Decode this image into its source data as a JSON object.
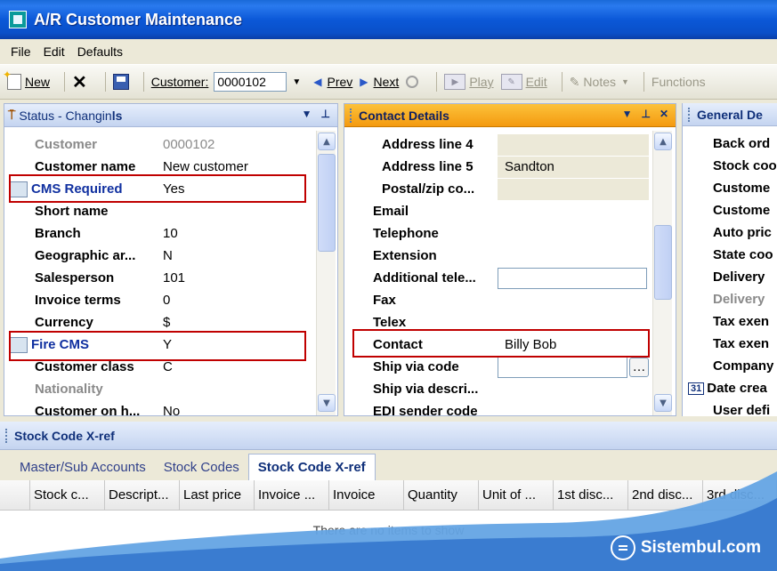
{
  "window": {
    "title": "A/R Customer Maintenance"
  },
  "menu": [
    "File",
    "Edit",
    "Defaults"
  ],
  "toolbar": {
    "new": "New",
    "customer_label": "Customer:",
    "customer_value": "0000102",
    "prev": "Prev",
    "next": "Next",
    "play": "Play",
    "edit": "Edit",
    "notes": "Notes",
    "functions": "Functions"
  },
  "left_panel": {
    "title": "Status - Changin",
    "title_suffix": "ls",
    "rows": [
      {
        "label": "Customer",
        "value": "0000102"
      },
      {
        "label": "Customer name",
        "value": "New customer"
      },
      {
        "label": "CMS Required",
        "value": "Yes"
      },
      {
        "label": "Short name",
        "value": ""
      },
      {
        "label": "Branch",
        "value": "10"
      },
      {
        "label": "Geographic ar...",
        "value": "N"
      },
      {
        "label": "Salesperson",
        "value": "101"
      },
      {
        "label": "Invoice terms",
        "value": "0"
      },
      {
        "label": "Currency",
        "value": "$"
      },
      {
        "label": "Fire CMS",
        "value": "Y"
      },
      {
        "label": "Customer class",
        "value": "C"
      },
      {
        "label": "Nationality",
        "value": ""
      },
      {
        "label": "Customer on h...",
        "value": "No"
      }
    ]
  },
  "mid_panel": {
    "title": "Contact Details",
    "rows": [
      {
        "label": "Address line 4",
        "value": ""
      },
      {
        "label": "Address line 5",
        "value": "Sandton"
      },
      {
        "label": "Postal/zip co...",
        "value": ""
      },
      {
        "label": "Email",
        "value": ""
      },
      {
        "label": "Telephone",
        "value": ""
      },
      {
        "label": "Extension",
        "value": ""
      },
      {
        "label": "Additional tele...",
        "value": ""
      },
      {
        "label": "Fax",
        "value": ""
      },
      {
        "label": "Telex",
        "value": ""
      },
      {
        "label": "Contact",
        "value": "Billy Bob"
      },
      {
        "label": "Ship via code",
        "value": ""
      },
      {
        "label": "Ship via descri...",
        "value": ""
      },
      {
        "label": "EDI sender code",
        "value": ""
      }
    ]
  },
  "right_panel": {
    "title": "General De",
    "rows": [
      "Back ord",
      "Stock coo",
      "Custome",
      "Custome",
      "Auto pric",
      "State coo",
      "Delivery",
      "Delivery",
      "Tax exen",
      "Tax exen",
      "Company",
      "Date crea",
      "User defi"
    ],
    "date_icon": "31"
  },
  "bottom_panel": {
    "title": "Stock Code X-ref",
    "tabs": [
      "Master/Sub Accounts",
      "Stock Codes",
      "Stock Code X-ref"
    ],
    "columns": [
      "Stock c...",
      "Descript...",
      "Last price",
      "Invoice ...",
      "Invoice",
      "Quantity",
      "Unit of ...",
      "1st disc...",
      "2nd disc...",
      "3rd disc..."
    ],
    "empty_message": "There are no items to show"
  },
  "brand": "Sistembul.com"
}
